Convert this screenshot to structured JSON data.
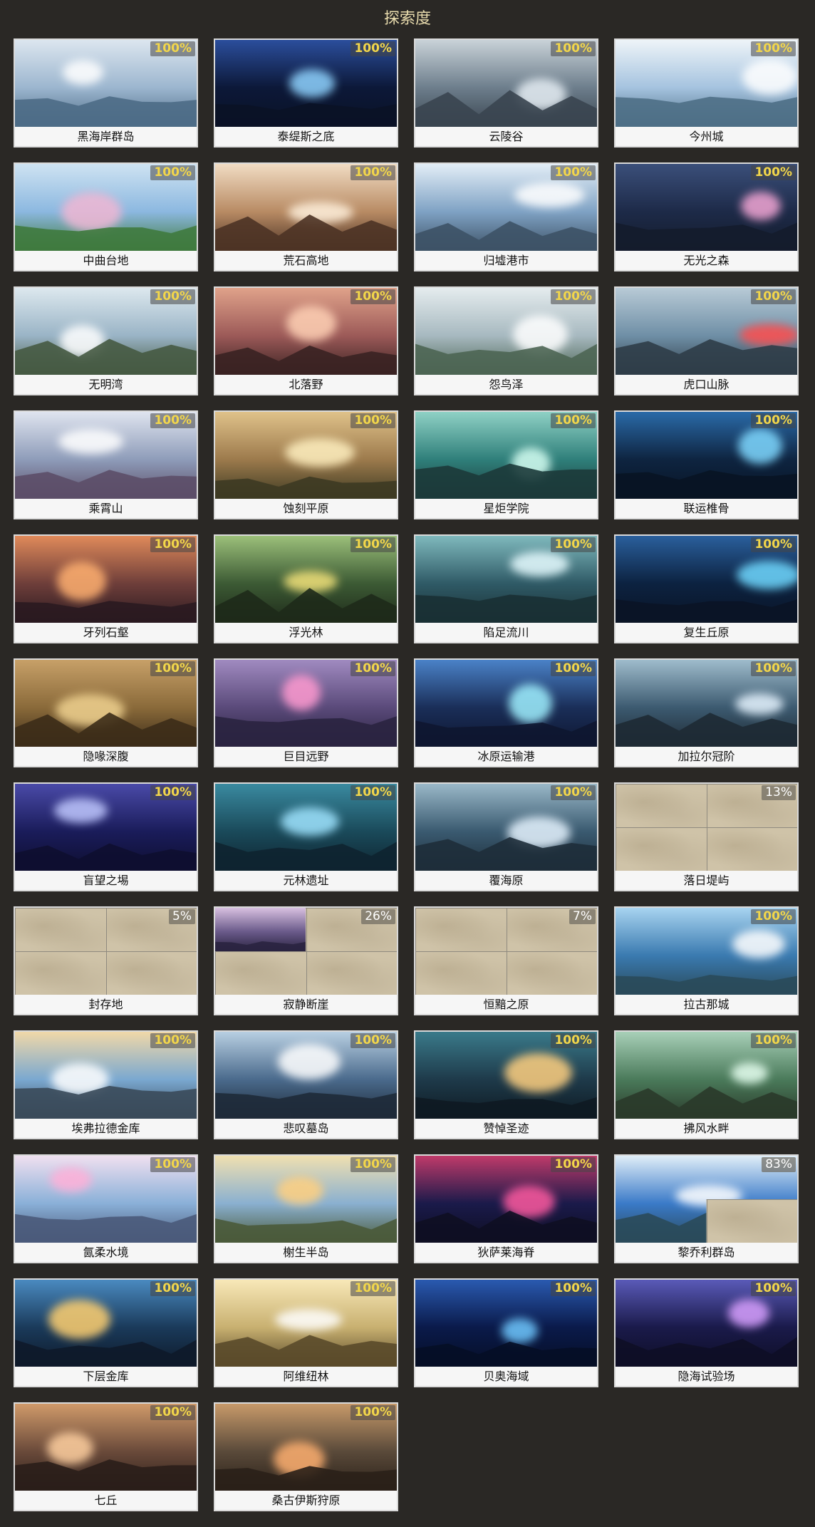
{
  "title": "探索度",
  "regions": [
    {
      "name": "黑海岸群岛",
      "progress": "100%",
      "partial": false,
      "colors": [
        "#9cb6cf",
        "#dce6ef",
        "#4d6b86"
      ],
      "glow": "#ffffff"
    },
    {
      "name": "泰缇斯之底",
      "progress": "100%",
      "partial": false,
      "colors": [
        "#0c1838",
        "#2b4e9c",
        "#0a1226"
      ],
      "glow": "#8fd3ff"
    },
    {
      "name": "云陵谷",
      "progress": "100%",
      "partial": false,
      "colors": [
        "#6d7e8c",
        "#c9d2d8",
        "#3a4550"
      ],
      "glow": "#e6eef4"
    },
    {
      "name": "今州城",
      "progress": "100%",
      "partial": false,
      "colors": [
        "#a5c3df",
        "#eef4f8",
        "#4e6f86"
      ],
      "glow": "#ffffff"
    },
    {
      "name": "中曲台地",
      "progress": "100%",
      "partial": false,
      "colors": [
        "#8cb8e0",
        "#cfe3f2",
        "#3f7a3e"
      ],
      "glow": "#f0b7d3"
    },
    {
      "name": "荒石高地",
      "progress": "100%",
      "partial": false,
      "colors": [
        "#b88b64",
        "#f1dcc3",
        "#4d3325"
      ],
      "glow": "#fff1dd"
    },
    {
      "name": "归墟港市",
      "progress": "100%",
      "partial": false,
      "colors": [
        "#7fa2c4",
        "#e3eef7",
        "#3d5266"
      ],
      "glow": "#ffffff"
    },
    {
      "name": "无光之森",
      "progress": "100%",
      "partial": false,
      "colors": [
        "#1d2a48",
        "#3b4f7a",
        "#141c2c"
      ],
      "glow": "#f3a6d5"
    },
    {
      "name": "无明湾",
      "progress": "100%",
      "partial": false,
      "colors": [
        "#9ab4c6",
        "#dde8ee",
        "#465a42"
      ],
      "glow": "#ffffff"
    },
    {
      "name": "北落野",
      "progress": "100%",
      "partial": false,
      "colors": [
        "#9c5a58",
        "#e0a28a",
        "#3a2222"
      ],
      "glow": "#ffd1b5"
    },
    {
      "name": "怨鸟泽",
      "progress": "100%",
      "partial": false,
      "colors": [
        "#a7b9c0",
        "#e5ecee",
        "#4d6553"
      ],
      "glow": "#ffffff"
    },
    {
      "name": "虎口山脉",
      "progress": "100%",
      "partial": false,
      "colors": [
        "#6f8fa6",
        "#b8cad6",
        "#2f3d48"
      ],
      "glow": "#ff4d4d"
    },
    {
      "name": "乘霄山",
      "progress": "100%",
      "partial": false,
      "colors": [
        "#8e9cb9",
        "#dfe4ef",
        "#5c4e68"
      ],
      "glow": "#ffffff"
    },
    {
      "name": "蚀刻平原",
      "progress": "100%",
      "partial": false,
      "colors": [
        "#9c7a4c",
        "#e0c28a",
        "#3d3a22"
      ],
      "glow": "#fff0c0"
    },
    {
      "name": "星炬学院",
      "progress": "100%",
      "partial": false,
      "colors": [
        "#2f7f7a",
        "#8fd1c5",
        "#1c3a3a"
      ],
      "glow": "#d6fff3"
    },
    {
      "name": "联运椎骨",
      "progress": "100%",
      "partial": false,
      "colors": [
        "#0e2440",
        "#2a6aa8",
        "#081424"
      ],
      "glow": "#7fd8ff"
    },
    {
      "name": "牙列石壑",
      "progress": "100%",
      "partial": false,
      "colors": [
        "#6e3e3a",
        "#e08a5a",
        "#2a1a20"
      ],
      "glow": "#ffb070"
    },
    {
      "name": "浮光林",
      "progress": "100%",
      "partial": false,
      "colors": [
        "#3c5a34",
        "#9cc07a",
        "#1e2a1a"
      ],
      "glow": "#f2e27a"
    },
    {
      "name": "陷足流川",
      "progress": "100%",
      "partial": false,
      "colors": [
        "#2f5a66",
        "#7fb9bd",
        "#1a3034"
      ],
      "glow": "#e6fbff"
    },
    {
      "name": "复生丘原",
      "progress": "100%",
      "partial": false,
      "colors": [
        "#0c2240",
        "#2a5f9c",
        "#0a1426"
      ],
      "glow": "#6fd8ff"
    },
    {
      "name": "隐喙深腹",
      "progress": "100%",
      "partial": false,
      "colors": [
        "#8a6a3a",
        "#c7a068",
        "#3c2c18"
      ],
      "glow": "#f0d290"
    },
    {
      "name": "巨目远野",
      "progress": "100%",
      "partial": false,
      "colors": [
        "#5a4a7a",
        "#a08ac0",
        "#2a2340"
      ],
      "glow": "#ff9ad0"
    },
    {
      "name": "冰原运输港",
      "progress": "100%",
      "partial": false,
      "colors": [
        "#1a2e58",
        "#4a82c8",
        "#0e1630"
      ],
      "glow": "#9ff0ff"
    },
    {
      "name": "加拉尔冠阶",
      "progress": "100%",
      "partial": false,
      "colors": [
        "#3c5a70",
        "#9fbccc",
        "#1e2a34"
      ],
      "glow": "#e6f4ff"
    },
    {
      "name": "盲望之埸",
      "progress": "100%",
      "partial": false,
      "colors": [
        "#1a1c5a",
        "#4a4aa8",
        "#0e0e30"
      ],
      "glow": "#c0c8ff"
    },
    {
      "name": "元林遗址",
      "progress": "100%",
      "partial": false,
      "colors": [
        "#1a4a5a",
        "#3a8aa0",
        "#0e2430"
      ],
      "glow": "#9fe4ff"
    },
    {
      "name": "覆海原",
      "progress": "100%",
      "partial": false,
      "colors": [
        "#3a5a70",
        "#9ab8c8",
        "#1e2e3a"
      ],
      "glow": "#e6f4ff"
    },
    {
      "name": "落日堤屿",
      "progress": "13%",
      "partial": true,
      "colors": [],
      "glow": ""
    },
    {
      "name": "封存地",
      "progress": "5%",
      "partial": true,
      "colors": [],
      "glow": ""
    },
    {
      "name": "寂静断崖",
      "progress": "26%",
      "partial": true,
      "colors": [
        "#6a5a8a",
        "#d8c0e0",
        "#2a2440"
      ],
      "glow": "#ffffff"
    },
    {
      "name": "恒黯之原",
      "progress": "7%",
      "partial": true,
      "colors": [],
      "glow": ""
    },
    {
      "name": "拉古那城",
      "progress": "100%",
      "partial": false,
      "colors": [
        "#3a7ab0",
        "#a8d4f0",
        "#2a4a5a"
      ],
      "glow": "#ffffff"
    },
    {
      "name": "埃弗拉德金库",
      "progress": "100%",
      "partial": false,
      "colors": [
        "#7aa8d0",
        "#f0d8a8",
        "#3a4a5a"
      ],
      "glow": "#ffffff"
    },
    {
      "name": "悲叹墓岛",
      "progress": "100%",
      "partial": false,
      "colors": [
        "#4a6a8c",
        "#b8cfe2",
        "#1e2a38"
      ],
      "glow": "#ffffff"
    },
    {
      "name": "赞悼圣迹",
      "progress": "100%",
      "partial": false,
      "colors": [
        "#1e3a4a",
        "#3a7a8a",
        "#0e1a22"
      ],
      "glow": "#ffd080"
    },
    {
      "name": "拂风水畔",
      "progress": "100%",
      "partial": false,
      "colors": [
        "#4a7a5a",
        "#a8d0b8",
        "#2a3a2a"
      ],
      "glow": "#e6fff0"
    },
    {
      "name": "氤柔水境",
      "progress": "100%",
      "partial": false,
      "colors": [
        "#8ab0d8",
        "#f0e0f0",
        "#4a5a7a"
      ],
      "glow": "#ffb0d8"
    },
    {
      "name": "榭生半岛",
      "progress": "100%",
      "partial": false,
      "colors": [
        "#8ab0d0",
        "#f0e0b0",
        "#4a5a3a"
      ],
      "glow": "#ffd080"
    },
    {
      "name": "狄萨莱海脊",
      "progress": "100%",
      "partial": false,
      "colors": [
        "#1a1a4a",
        "#c03a6a",
        "#0e0e22"
      ],
      "glow": "#ff5aa0"
    },
    {
      "name": "黎乔利群岛",
      "progress": "83%",
      "partial": true,
      "colors": [
        "#3a7ac8",
        "#e0eef8",
        "#2a4a5a"
      ],
      "glow": "#ffffff"
    },
    {
      "name": "下层金库",
      "progress": "100%",
      "partial": false,
      "colors": [
        "#1a3a5a",
        "#4a8ac0",
        "#0e1a2a"
      ],
      "glow": "#ffd070"
    },
    {
      "name": "阿维纽林",
      "progress": "100%",
      "partial": false,
      "colors": [
        "#c8b070",
        "#f8e8b8",
        "#5a4a2a"
      ],
      "glow": "#ffffff"
    },
    {
      "name": "贝奥海域",
      "progress": "100%",
      "partial": false,
      "colors": [
        "#0a1a4a",
        "#2a5ab0",
        "#060e26"
      ],
      "glow": "#6fc8ff"
    },
    {
      "name": "隐海试验场",
      "progress": "100%",
      "partial": false,
      "colors": [
        "#1a1a4a",
        "#5a5ab8",
        "#0e0e26"
      ],
      "glow": "#d8a0ff"
    },
    {
      "name": "七丘",
      "progress": "100%",
      "partial": false,
      "colors": [
        "#6a4a3a",
        "#d09a6a",
        "#2a1e1a"
      ],
      "glow": "#ffd0a0"
    },
    {
      "name": "桑古伊斯狩原",
      "progress": "100%",
      "partial": false,
      "colors": [
        "#5a4a3a",
        "#c89a6a",
        "#2a2018"
      ],
      "glow": "#ffb070"
    }
  ]
}
